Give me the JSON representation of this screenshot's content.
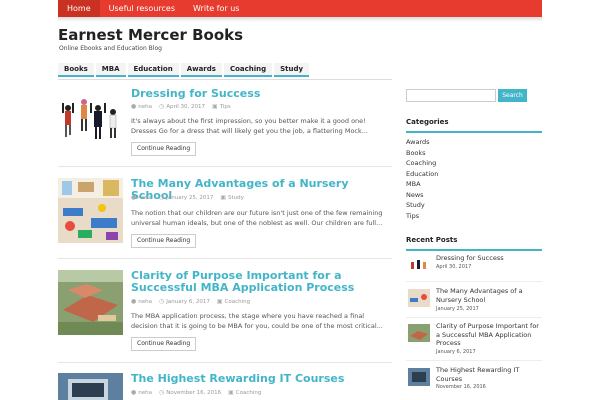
{
  "topnav": [
    {
      "label": "Home"
    },
    {
      "label": "Useful resources"
    },
    {
      "label": "Write for us"
    }
  ],
  "site": {
    "title": "Earnest Mercer Books",
    "description": "Online Ebooks and Education Blog"
  },
  "catnav": [
    {
      "label": "Books"
    },
    {
      "label": "MBA"
    },
    {
      "label": "Education"
    },
    {
      "label": "Awards"
    },
    {
      "label": "Coaching"
    },
    {
      "label": "Study"
    }
  ],
  "posts": [
    {
      "title": "Dressing for Success",
      "author": "neha",
      "date": "April 30, 2017",
      "category": "Tips",
      "excerpt": "It's always about the first impression, so you better make it a good one! Dresses Go for a dress that will likely get you the job, a flattering Mock...",
      "button": "Continue Reading"
    },
    {
      "title": "The Many Advantages of a Nursery School",
      "author": "neha",
      "date": "January 25, 2017",
      "category": "Study",
      "excerpt": "The notion that our children are our future isn't just one of the few remaining universal human ideals, but one of the noblest as well. Our children are full...",
      "button": "Continue Reading"
    },
    {
      "title": "Clarity of Purpose Important for a Successful MBA Application Process",
      "author": "neha",
      "date": "January 6, 2017",
      "category": "Coaching",
      "excerpt": "The MBA application process, the stage where you have reached a final decision that it is going to be MBA for you, could be one of the most critical...",
      "button": "Continue Reading"
    },
    {
      "title": "The Highest Rewarding IT Courses",
      "author": "neha",
      "date": "November 16, 2016",
      "category": "Coaching"
    }
  ],
  "sidebar": {
    "search": {
      "placeholder": "",
      "button": "Search"
    },
    "categories_title": "Categories",
    "categories": [
      "Awards",
      "Books",
      "Coaching",
      "Education",
      "MBA",
      "News",
      "Study",
      "Tips"
    ],
    "recent_title": "Recent Posts",
    "recent": [
      {
        "title": "Dressing for Success",
        "date": "April 30, 2017"
      },
      {
        "title": "The Many Advantages of a Nursery School",
        "date": "January 25, 2017"
      },
      {
        "title": "Clarity of Purpose Important for a Successful MBA Application Process",
        "date": "January 6, 2017"
      },
      {
        "title": "The Highest Rewarding IT Courses",
        "date": "November 16, 2016"
      }
    ]
  },
  "colors": {
    "accent": "#43b5c9",
    "topbar": "#e63b2e"
  }
}
